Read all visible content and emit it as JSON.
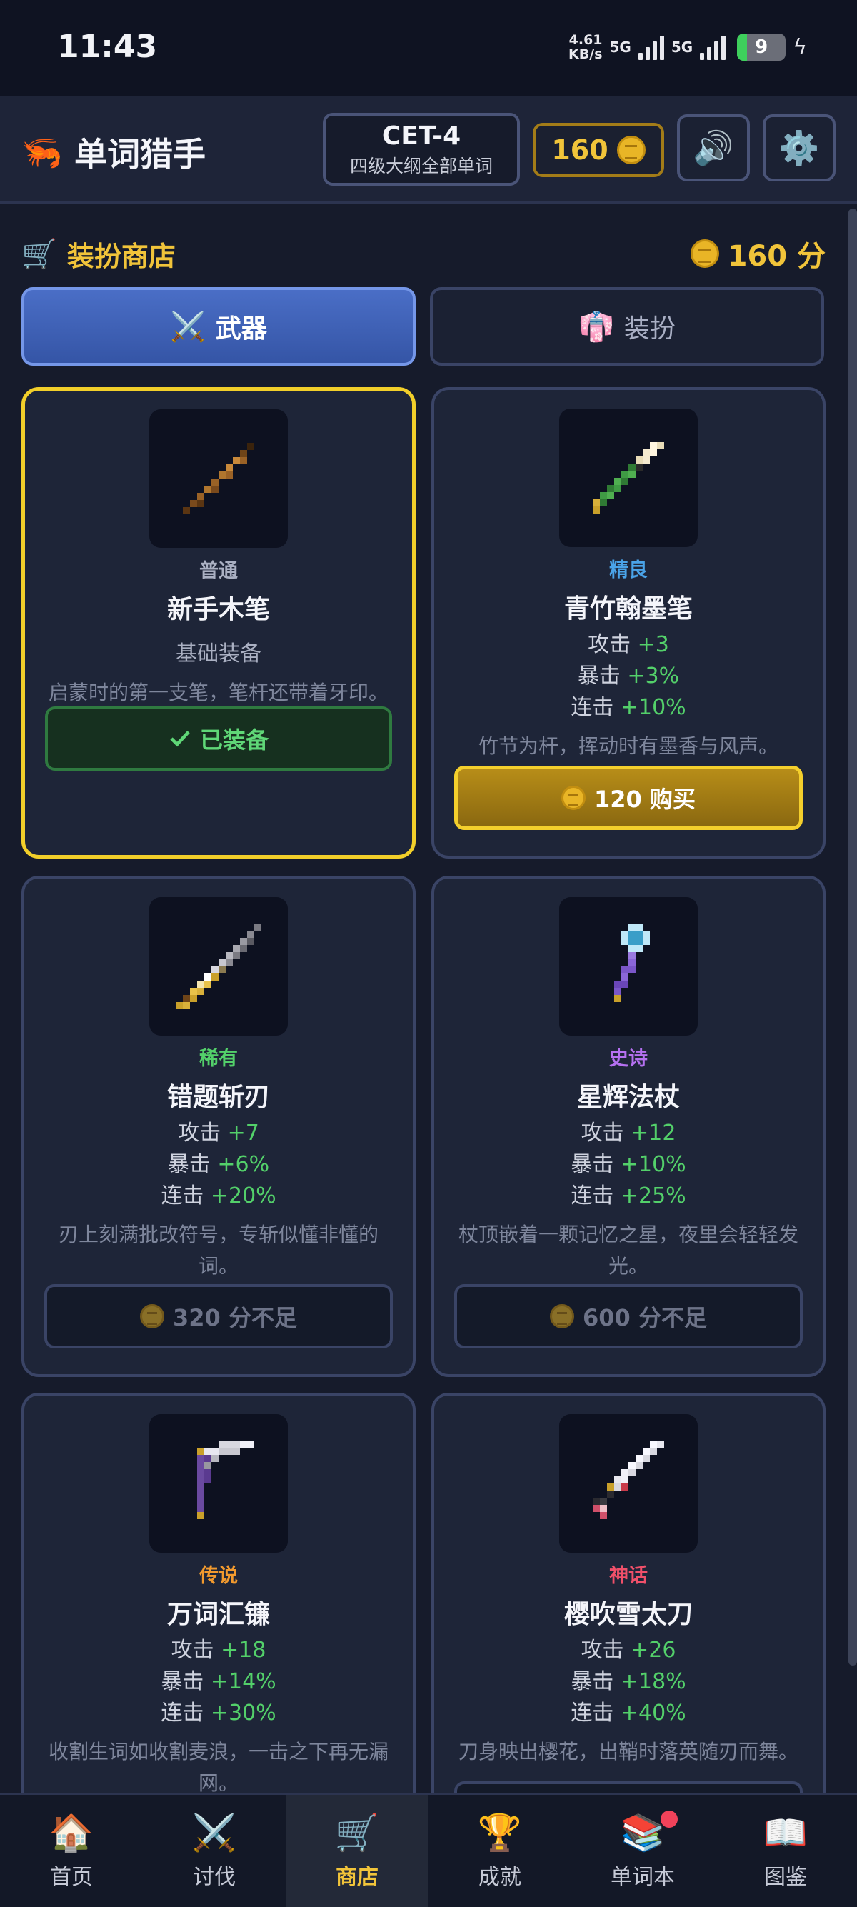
{
  "status_bar": {
    "time": "11:43",
    "speed_value": "4.61",
    "speed_unit": "KB/s",
    "network_1": "5G",
    "network_2": "5G",
    "battery": "9"
  },
  "header": {
    "app_title": "单词猎手",
    "logo_icon": "shrimp-icon",
    "cet_level": "CET-4",
    "cet_subtitle": "四级大纲全部单词",
    "coins": "160"
  },
  "shop": {
    "title": "装扮商店",
    "points": "160 分",
    "tabs": [
      {
        "label": "武器",
        "icon": "crossed-swords-icon",
        "active": true
      },
      {
        "label": "装扮",
        "icon": "kimono-icon",
        "active": false
      }
    ],
    "items": [
      {
        "rarity": "普通",
        "rarity_color": "#aab0c2",
        "name": "新手木笔",
        "basic": "基础装备",
        "description": "启蒙时的第一支笔，笔杆还带着牙印。",
        "action": "已装备",
        "state": "equipped"
      },
      {
        "rarity": "精良",
        "rarity_color": "#4aa3e8",
        "name": "青竹翰墨笔",
        "stats": [
          {
            "label": "攻击",
            "value": "+3"
          },
          {
            "label": "暴击",
            "value": "+3%"
          },
          {
            "label": "连击",
            "value": "+10%"
          }
        ],
        "description": "竹节为杆，挥动时有墨香与风声。",
        "action": "120 购买",
        "state": "buy"
      },
      {
        "rarity": "稀有",
        "rarity_color": "#53d06a",
        "name": "错题斩刃",
        "stats": [
          {
            "label": "攻击",
            "value": "+7"
          },
          {
            "label": "暴击",
            "value": "+6%"
          },
          {
            "label": "连击",
            "value": "+20%"
          }
        ],
        "description": "刃上刻满批改符号，专斩似懂非懂的词。",
        "action": "320 分不足",
        "state": "insufficient"
      },
      {
        "rarity": "史诗",
        "rarity_color": "#b570f0",
        "name": "星辉法杖",
        "stats": [
          {
            "label": "攻击",
            "value": "+12"
          },
          {
            "label": "暴击",
            "value": "+10%"
          },
          {
            "label": "连击",
            "value": "+25%"
          }
        ],
        "description": "杖顶嵌着一颗记忆之星，夜里会轻轻发光。",
        "action": "600 分不足",
        "state": "insufficient"
      },
      {
        "rarity": "传说",
        "rarity_color": "#f29a2e",
        "name": "万词汇镰",
        "stats": [
          {
            "label": "攻击",
            "value": "+18"
          },
          {
            "label": "暴击",
            "value": "+14%"
          },
          {
            "label": "连击",
            "value": "+30%"
          }
        ],
        "description": "收割生词如收割麦浪，一击之下再无漏网。"
      },
      {
        "rarity": "神话",
        "rarity_color": "#f0506a",
        "name": "樱吹雪太刀",
        "stats": [
          {
            "label": "攻击",
            "value": "+26"
          },
          {
            "label": "暴击",
            "value": "+18%"
          },
          {
            "label": "连击",
            "value": "+40%"
          }
        ],
        "description": "刀身映出樱花，出鞘时落英随刃而舞。"
      }
    ]
  },
  "bottom_nav": [
    {
      "label": "首页",
      "icon": "house-icon"
    },
    {
      "label": "讨伐",
      "icon": "crossed-swords-icon"
    },
    {
      "label": "商店",
      "icon": "cart-icon",
      "active": true
    },
    {
      "label": "成就",
      "icon": "trophy-icon"
    },
    {
      "label": "单词本",
      "icon": "books-icon",
      "badge": true
    },
    {
      "label": "图鉴",
      "icon": "open-book-icon"
    }
  ]
}
